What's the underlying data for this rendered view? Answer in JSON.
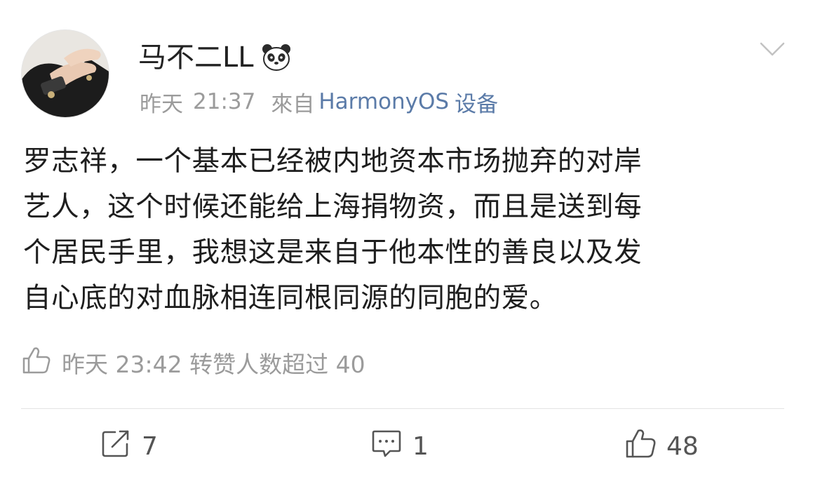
{
  "user": {
    "name": "马不二LL",
    "badge_icon": "panda-icon"
  },
  "meta": {
    "day": "昨天",
    "time": "21:37",
    "from_label": "來自",
    "source": "HarmonyOS",
    "source_suffix": "设备"
  },
  "post": {
    "lines": [
      "罗志祥，一个基本已经被内地资本市场抛弃的对岸",
      "艺人，这个时候还能给上海捐物资，而且是送到每",
      "个居民手里，我想这是来自于他本性的善良以及发",
      "自心底的对血脉相连同根同源的同胞的爱。"
    ]
  },
  "like_note": {
    "icon": "thumbs-up-outline-icon",
    "text": "昨天 23:42 转赞人数超过 40"
  },
  "actions": {
    "repost": {
      "icon": "repost-icon",
      "count": "7"
    },
    "comment": {
      "icon": "comment-icon",
      "count": "1"
    },
    "like": {
      "icon": "thumbs-up-icon",
      "count": "48"
    }
  },
  "colors": {
    "link": "#5b7ba8",
    "meta": "#9b9b9b",
    "text": "#1e1e1e"
  }
}
